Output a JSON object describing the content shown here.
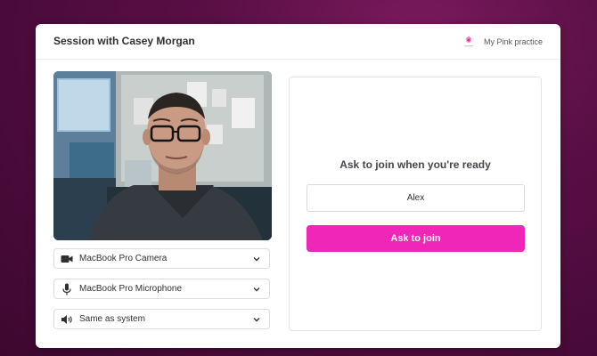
{
  "header": {
    "title": "Session with Casey Morgan",
    "practice_name": "My Pink practice",
    "logo_icon": "pink-flower-logo"
  },
  "preview": {
    "description_icon": "camera-preview"
  },
  "devices": {
    "camera": {
      "label": "MacBook Pro Camera",
      "icon": "video-camera-icon"
    },
    "microphone": {
      "label": "MacBook Pro Microphone",
      "icon": "microphone-icon"
    },
    "speaker": {
      "label": "Same as system",
      "icon": "speaker-icon"
    }
  },
  "join": {
    "heading": "Ask to join when you're ready",
    "name_value": "Alex",
    "button_label": "Ask to join"
  },
  "colors": {
    "background": "#5a0f45",
    "accent": "#f026b8",
    "card": "#ffffff"
  }
}
